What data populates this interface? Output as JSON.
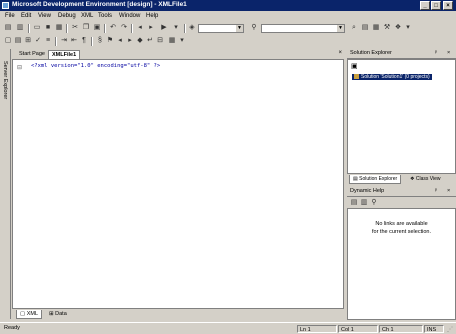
{
  "window": {
    "title": "Microsoft Development Environment [design] - XMLFile1"
  },
  "menu": [
    "File",
    "Edit",
    "View",
    "Debug",
    "XML",
    "Tools",
    "Window",
    "Help"
  ],
  "editor": {
    "tabs": [
      "Start Page",
      "XMLFile1"
    ],
    "active_tab": "XMLFile1",
    "code_line": "<?xml version=\"1.0\" encoding=\"utf-8\" ?>",
    "bottom_tabs": [
      "XML",
      "Data"
    ]
  },
  "left_sidebar": {
    "label": "Server Explorer"
  },
  "solution_explorer": {
    "title": "Solution Explorer",
    "tree_item": "Solution 'Solution1' (0 projects)",
    "tabs": [
      "Solution Explorer",
      "Class View"
    ]
  },
  "dynamic_help": {
    "title": "Dynamic Help",
    "message_line1": "No links are available",
    "message_line2": "for the current selection."
  },
  "status": {
    "text": "Ready",
    "ln": "Ln 1",
    "col": "Col 1",
    "ch": "Ch 1",
    "ins": "INS"
  },
  "colors": {
    "title_bar": "#0a246a",
    "chrome": "#d4d0c8",
    "selection": "#0a246a"
  }
}
